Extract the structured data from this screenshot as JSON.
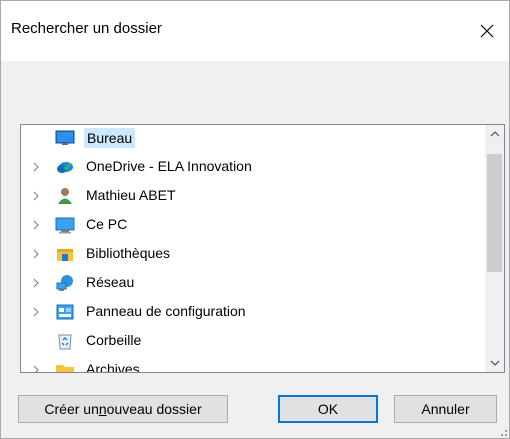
{
  "window": {
    "title": "Rechercher un dossier"
  },
  "tree": {
    "items": [
      {
        "label": "Bureau",
        "icon": "desktop-icon",
        "selected": true,
        "has_children": false
      },
      {
        "label": "OneDrive - ELA Innovation",
        "icon": "onedrive-cloud-icon",
        "has_children": true
      },
      {
        "label": "Mathieu ABET",
        "icon": "user-folder-icon",
        "has_children": true
      },
      {
        "label": "Ce PC",
        "icon": "computer-icon",
        "has_children": true
      },
      {
        "label": "Bibliothèques",
        "icon": "libraries-icon",
        "has_children": true
      },
      {
        "label": "Réseau",
        "icon": "network-icon",
        "has_children": true
      },
      {
        "label": "Panneau de configuration",
        "icon": "control-panel-icon",
        "has_children": true
      },
      {
        "label": "Corbeille",
        "icon": "recycle-bin-icon",
        "has_children": false
      },
      {
        "label": "Archives",
        "icon": "folder-icon",
        "has_children": false
      }
    ]
  },
  "buttons": {
    "new_folder_pre": "Créer un ",
    "new_folder_mnemonic": "n",
    "new_folder_post": "ouveau dossier",
    "ok": "OK",
    "cancel": "Annuler"
  },
  "colors": {
    "selection": "#cce8ff",
    "default_button_border": "#0078d7"
  }
}
